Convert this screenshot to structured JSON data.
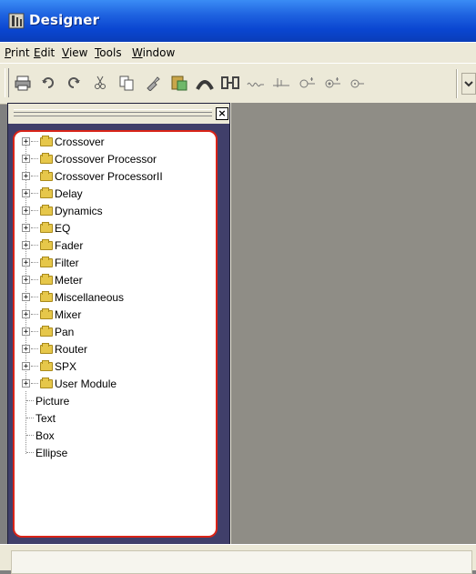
{
  "window": {
    "title": "Designer"
  },
  "menubar": {
    "items": [
      {
        "label": "rint",
        "accel": "P"
      },
      {
        "label": "dit",
        "accel": "E"
      },
      {
        "label": "iew",
        "accel": "V"
      },
      {
        "label": "ools",
        "accel": "T"
      },
      {
        "label": "indow",
        "accel": "W"
      }
    ]
  },
  "toolbar": {
    "buttons": [
      "print-icon",
      "undo-icon",
      "redo-icon",
      "cut-icon",
      "copy-icon",
      "paint-icon",
      "paste-icon",
      "arc-icon",
      "link-icon",
      "meter-icon",
      "fader-icon",
      "filter-icon",
      "eq-icon",
      "dial-icon",
      "dropdown-icon"
    ]
  },
  "panel": {
    "close_label": "×"
  },
  "tree": {
    "folders": [
      "Crossover",
      "Crossover Processor",
      "Crossover ProcessorII",
      "Delay",
      "Dynamics",
      "EQ",
      "Fader",
      "Filter",
      "Meter",
      "Miscellaneous",
      "Mixer",
      "Pan",
      "Router",
      "SPX",
      "User Module"
    ],
    "leaves": [
      "Picture",
      "Text",
      "Box",
      "Ellipse"
    ]
  },
  "colors": {
    "titlebar": "#0a46d1",
    "panel_bg": "#403f6a",
    "tree_border": "#d92418",
    "canvas": "#8f8d86"
  }
}
